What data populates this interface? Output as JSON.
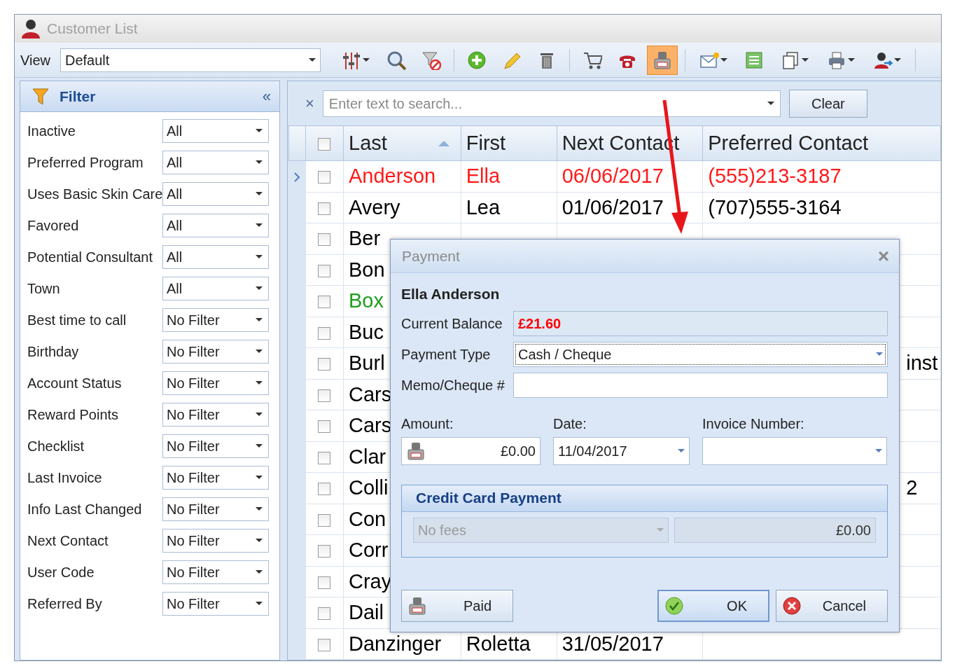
{
  "window": {
    "title": "Customer List"
  },
  "view": {
    "label": "View",
    "value": "Default"
  },
  "toolbar": [
    {
      "kind": "columns",
      "dropdown": true,
      "selected": false
    },
    {
      "kind": "search",
      "dropdown": false,
      "selected": false
    },
    {
      "kind": "clear-filter",
      "dropdown": false,
      "selected": false
    },
    {
      "kind": "separator"
    },
    {
      "kind": "add",
      "dropdown": false,
      "selected": false
    },
    {
      "kind": "edit",
      "dropdown": false,
      "selected": false
    },
    {
      "kind": "delete",
      "dropdown": false,
      "selected": false
    },
    {
      "kind": "separator"
    },
    {
      "kind": "cart",
      "dropdown": false,
      "selected": false
    },
    {
      "kind": "phone",
      "dropdown": false,
      "selected": false
    },
    {
      "kind": "paid",
      "dropdown": false,
      "selected": true
    },
    {
      "kind": "separator"
    },
    {
      "kind": "mail",
      "dropdown": true,
      "selected": false
    },
    {
      "kind": "list",
      "dropdown": false,
      "selected": false
    },
    {
      "kind": "copy",
      "dropdown": true,
      "selected": false
    },
    {
      "kind": "print",
      "dropdown": true,
      "selected": false
    },
    {
      "kind": "user",
      "dropdown": true,
      "selected": false
    },
    {
      "kind": "separator"
    }
  ],
  "filter": {
    "title": "Filter",
    "collapse": "«",
    "items": [
      {
        "label": "Inactive",
        "value": "All"
      },
      {
        "label": "Preferred Program",
        "value": "All"
      },
      {
        "label": "Uses Basic Skin Care",
        "value": "All"
      },
      {
        "label": "Favored",
        "value": "All"
      },
      {
        "label": "Potential Consultant",
        "value": "All"
      },
      {
        "label": "Town",
        "value": "All"
      },
      {
        "label": "Best time to call",
        "value": "No Filter"
      },
      {
        "label": "Birthday",
        "value": "No Filter"
      },
      {
        "label": "Account Status",
        "value": "No Filter"
      },
      {
        "label": "Reward Points",
        "value": "No Filter"
      },
      {
        "label": "Checklist",
        "value": "No Filter"
      },
      {
        "label": "Last Invoice",
        "value": "No Filter"
      },
      {
        "label": "Info Last Changed",
        "value": "No Filter"
      },
      {
        "label": "Next Contact",
        "value": "No Filter"
      },
      {
        "label": "User Code",
        "value": "No Filter"
      },
      {
        "label": "Referred By",
        "value": "No Filter"
      }
    ]
  },
  "search": {
    "clear_glyph": "×",
    "placeholder": "Enter text to search...",
    "button": "Clear"
  },
  "table": {
    "all_checked": false,
    "columns": [
      {
        "label": "Last",
        "sorted": true
      },
      {
        "label": "First",
        "sorted": false
      },
      {
        "label": "Next Contact",
        "sorted": false
      },
      {
        "label": "Preferred Contact",
        "sorted": false
      }
    ],
    "rows": [
      {
        "last": "Anderson",
        "first": "Ella",
        "next_contact": "06/06/2017",
        "preferred_contact": "(555)213-3187",
        "color": "#ff1a1a",
        "current": true,
        "checked": false
      },
      {
        "last": "Avery",
        "first": "Lea",
        "next_contact": "01/06/2017",
        "preferred_contact": "(707)555-3164",
        "color": "#000000",
        "current": false,
        "checked": false
      },
      {
        "last": "Ber",
        "color": "#000000",
        "current": false,
        "checked": false
      },
      {
        "last": "Bon",
        "color": "#000000",
        "current": false,
        "checked": false
      },
      {
        "last": "Box",
        "color": "#1e9e1e",
        "current": false,
        "checked": false
      },
      {
        "last": "Buc",
        "color": "#000000",
        "current": false,
        "checked": false
      },
      {
        "last": "Burl",
        "preferred_contact_tail": "inst",
        "color": "#000000",
        "current": false,
        "checked": false
      },
      {
        "last": "Cars",
        "color": "#000000",
        "current": false,
        "checked": false
      },
      {
        "last": "Cars",
        "color": "#000000",
        "current": false,
        "checked": false
      },
      {
        "last": "Clar",
        "color": "#000000",
        "current": false,
        "checked": false
      },
      {
        "last": "Colli",
        "preferred_contact_tail": "2",
        "color": "#000000",
        "current": false,
        "checked": false
      },
      {
        "last": "Con",
        "color": "#000000",
        "current": false,
        "checked": false
      },
      {
        "last": "Corr",
        "color": "#000000",
        "current": false,
        "checked": false
      },
      {
        "last": "Cray",
        "color": "#000000",
        "current": false,
        "checked": false
      },
      {
        "last": "Dail",
        "color": "#000000",
        "current": false,
        "checked": false
      },
      {
        "last": "Danzinger",
        "first": "Roletta",
        "next_contact": "31/05/2017",
        "color": "#000000",
        "current": false,
        "checked": false
      }
    ]
  },
  "dialog": {
    "title": "Payment",
    "close": "×",
    "customer": "Ella Anderson",
    "balance": {
      "label": "Current Balance",
      "value": "£21.60"
    },
    "payment_type": {
      "label": "Payment Type",
      "value": "Cash / Cheque",
      "focused": true
    },
    "memo": {
      "label": "Memo/Cheque #"
    },
    "amount": {
      "label": "Amount:",
      "value": "£0.00"
    },
    "date": {
      "label": "Date:",
      "value": "11/04/2017"
    },
    "invoice": {
      "label": "Invoice Number:"
    },
    "credit_card": {
      "title": "Credit Card Payment",
      "fees": "No fees",
      "fee_amount": "£0.00",
      "disabled": true
    },
    "buttons": [
      {
        "kind": "paid",
        "label": "Paid",
        "default": false
      },
      {
        "kind": "ok",
        "label": "OK",
        "default": true
      },
      {
        "kind": "cancel",
        "label": "Cancel",
        "default": false
      }
    ]
  }
}
